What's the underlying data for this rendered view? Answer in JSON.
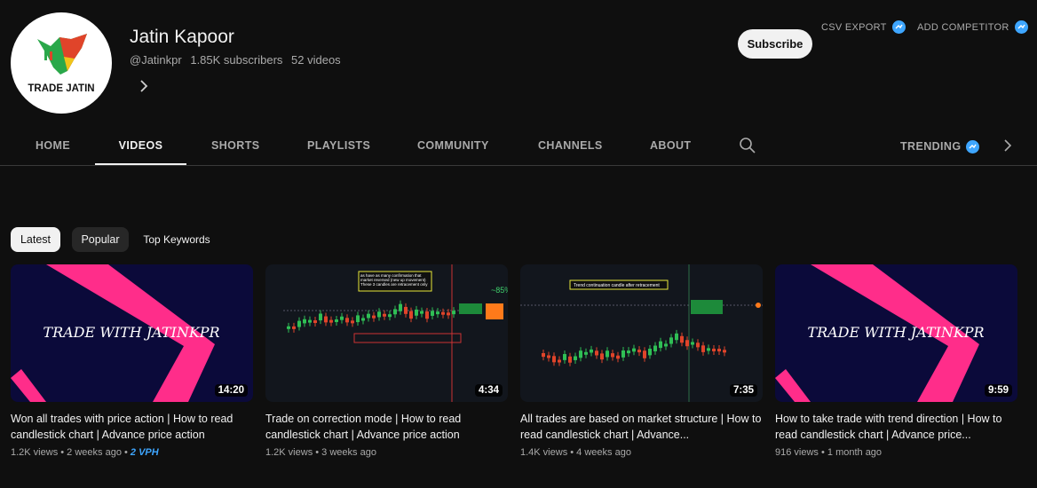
{
  "channel": {
    "name": "Jatin Kapoor",
    "handle": "@Jatinkpr",
    "subscribers": "1.85K subscribers",
    "videos": "52 videos",
    "logo_text": "TRADE JATIN"
  },
  "actions": {
    "subscribe": "Subscribe",
    "csv_export": "CSV EXPORT",
    "add_competitor": "ADD COMPETITOR"
  },
  "tabs": [
    "HOME",
    "VIDEOS",
    "SHORTS",
    "PLAYLISTS",
    "COMMUNITY",
    "CHANNELS",
    "ABOUT"
  ],
  "trending": "TRENDING",
  "filters": {
    "latest": "Latest",
    "popular": "Popular",
    "top_keywords": "Top Keywords"
  },
  "videos": [
    {
      "title": "Won all trades with price action | How to read candlestick chart | Advance price action",
      "views": "1.2K views",
      "age": "2 weeks ago",
      "vph": "2 VPH",
      "duration": "14:20",
      "thumb_text": "TRADE WITH JATINKPR"
    },
    {
      "title": "Trade on correction mode | How to read candlestick chart | Advance price action",
      "views": "1.2K views",
      "age": "3 weeks ago",
      "duration": "4:34",
      "thumb_text": "as have as many confirmation that market reversed (new up movement) These 3 candles are retracement only"
    },
    {
      "title": "All trades are based on market structure | How to read candlestick chart | Advance...",
      "views": "1.4K views",
      "age": "4 weeks ago",
      "duration": "7:35",
      "thumb_text": "Trend continuation candle after retracement"
    },
    {
      "title": "How to take trade with trend direction | How to read candlestick chart | Advance price...",
      "views": "916 views",
      "age": "1 month ago",
      "duration": "9:59",
      "thumb_text": "TRADE WITH JATINKPR"
    }
  ],
  "colors": {
    "background": "#0f0f0f",
    "accent_blue": "#3ea6ff",
    "thumb_pink": "#ff2d8a",
    "thumb_navy": "#0b0a3a"
  }
}
